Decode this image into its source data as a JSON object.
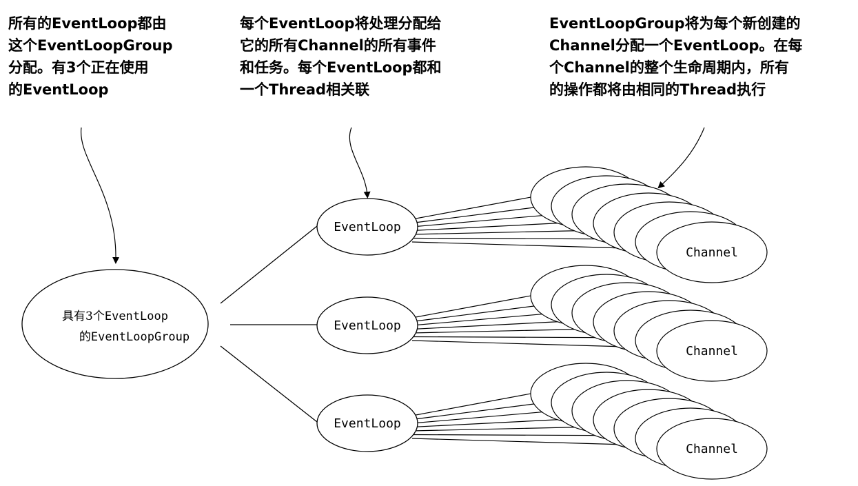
{
  "callouts": {
    "group": [
      "所有的EventLoop都由",
      "这个EventLoopGroup",
      "分配。有3个正在使用",
      "的EventLoop"
    ],
    "event_loop": [
      "每个EventLoop将处理分配给",
      "它的所有Channel的所有事件",
      "和任务。每个EventLoop都和",
      "一个Thread相关联"
    ],
    "channel": [
      "EventLoopGroup将为每个新创建的",
      "Channel分配一个EventLoop。在每",
      "个Channel的整个生命周期内，所有",
      "的操作都将由相同的Thread执行"
    ]
  },
  "group_node": {
    "line1_prefix": "具有3个",
    "line1_suffix": "EventLoop",
    "line2_prefix": "的",
    "line2_suffix": "EventLoopGroup"
  },
  "event_loops": [
    {
      "label": "EventLoop",
      "channel_label": "Channel"
    },
    {
      "label": "EventLoop",
      "channel_label": "Channel"
    },
    {
      "label": "EventLoop",
      "channel_label": "Channel"
    }
  ],
  "colors": {
    "stroke": "#000000",
    "fill": "#ffffff",
    "text": "#000000"
  }
}
